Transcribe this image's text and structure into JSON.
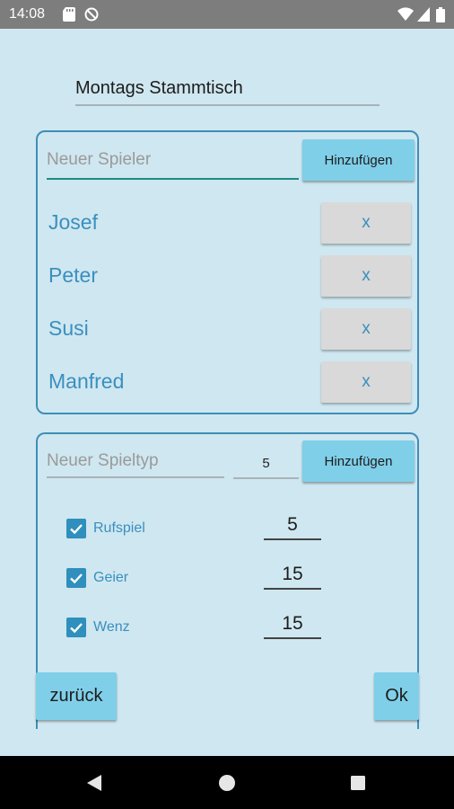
{
  "status_bar": {
    "time": "14:08",
    "left_icons": [
      "sd-card-icon",
      "no-disturb-icon"
    ],
    "right_icons": [
      "wifi-icon",
      "signal-icon",
      "battery-icon"
    ]
  },
  "group": {
    "name": "Montags Stammtisch"
  },
  "players": {
    "input_placeholder": "Neuer Spieler",
    "add_label": "Hinzufügen",
    "list": [
      {
        "name": "Josef",
        "remove_label": "x"
      },
      {
        "name": "Peter",
        "remove_label": "x"
      },
      {
        "name": "Susi",
        "remove_label": "x"
      },
      {
        "name": "Manfred",
        "remove_label": "x"
      }
    ]
  },
  "game_types": {
    "input_placeholder": "Neuer Spieltyp",
    "default_points": "5",
    "add_label": "Hinzufügen",
    "list": [
      {
        "name": "Rufspiel",
        "points": "5",
        "checked": true
      },
      {
        "name": "Geier",
        "points": "15",
        "checked": true
      },
      {
        "name": "Wenz",
        "points": "15",
        "checked": true
      }
    ]
  },
  "actions": {
    "back_label": "zurück",
    "ok_label": "Ok"
  },
  "colors": {
    "background": "#cfe7f0",
    "accent": "#3f8eb8",
    "button": "#7fcfe9",
    "status_bar": "#7d7d7d",
    "nav_bar": "#000000"
  }
}
